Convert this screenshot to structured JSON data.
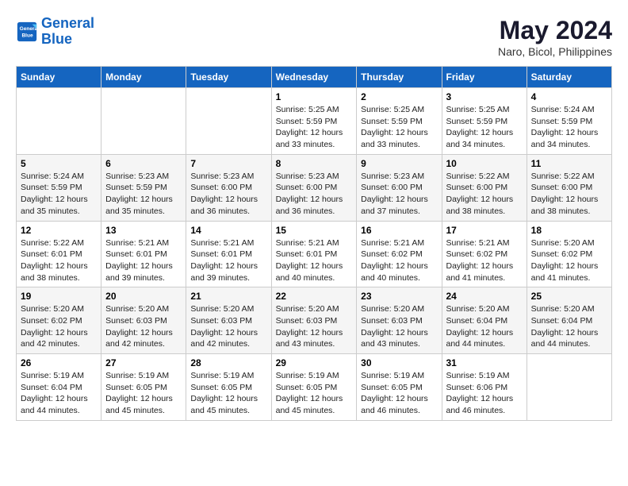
{
  "header": {
    "logo_line1": "General",
    "logo_line2": "Blue",
    "month_year": "May 2024",
    "location": "Naro, Bicol, Philippines"
  },
  "weekdays": [
    "Sunday",
    "Monday",
    "Tuesday",
    "Wednesday",
    "Thursday",
    "Friday",
    "Saturday"
  ],
  "weeks": [
    [
      {
        "day": "",
        "info": ""
      },
      {
        "day": "",
        "info": ""
      },
      {
        "day": "",
        "info": ""
      },
      {
        "day": "1",
        "info": "Sunrise: 5:25 AM\nSunset: 5:59 PM\nDaylight: 12 hours\nand 33 minutes."
      },
      {
        "day": "2",
        "info": "Sunrise: 5:25 AM\nSunset: 5:59 PM\nDaylight: 12 hours\nand 33 minutes."
      },
      {
        "day": "3",
        "info": "Sunrise: 5:25 AM\nSunset: 5:59 PM\nDaylight: 12 hours\nand 34 minutes."
      },
      {
        "day": "4",
        "info": "Sunrise: 5:24 AM\nSunset: 5:59 PM\nDaylight: 12 hours\nand 34 minutes."
      }
    ],
    [
      {
        "day": "5",
        "info": "Sunrise: 5:24 AM\nSunset: 5:59 PM\nDaylight: 12 hours\nand 35 minutes."
      },
      {
        "day": "6",
        "info": "Sunrise: 5:23 AM\nSunset: 5:59 PM\nDaylight: 12 hours\nand 35 minutes."
      },
      {
        "day": "7",
        "info": "Sunrise: 5:23 AM\nSunset: 6:00 PM\nDaylight: 12 hours\nand 36 minutes."
      },
      {
        "day": "8",
        "info": "Sunrise: 5:23 AM\nSunset: 6:00 PM\nDaylight: 12 hours\nand 36 minutes."
      },
      {
        "day": "9",
        "info": "Sunrise: 5:23 AM\nSunset: 6:00 PM\nDaylight: 12 hours\nand 37 minutes."
      },
      {
        "day": "10",
        "info": "Sunrise: 5:22 AM\nSunset: 6:00 PM\nDaylight: 12 hours\nand 38 minutes."
      },
      {
        "day": "11",
        "info": "Sunrise: 5:22 AM\nSunset: 6:00 PM\nDaylight: 12 hours\nand 38 minutes."
      }
    ],
    [
      {
        "day": "12",
        "info": "Sunrise: 5:22 AM\nSunset: 6:01 PM\nDaylight: 12 hours\nand 38 minutes."
      },
      {
        "day": "13",
        "info": "Sunrise: 5:21 AM\nSunset: 6:01 PM\nDaylight: 12 hours\nand 39 minutes."
      },
      {
        "day": "14",
        "info": "Sunrise: 5:21 AM\nSunset: 6:01 PM\nDaylight: 12 hours\nand 39 minutes."
      },
      {
        "day": "15",
        "info": "Sunrise: 5:21 AM\nSunset: 6:01 PM\nDaylight: 12 hours\nand 40 minutes."
      },
      {
        "day": "16",
        "info": "Sunrise: 5:21 AM\nSunset: 6:02 PM\nDaylight: 12 hours\nand 40 minutes."
      },
      {
        "day": "17",
        "info": "Sunrise: 5:21 AM\nSunset: 6:02 PM\nDaylight: 12 hours\nand 41 minutes."
      },
      {
        "day": "18",
        "info": "Sunrise: 5:20 AM\nSunset: 6:02 PM\nDaylight: 12 hours\nand 41 minutes."
      }
    ],
    [
      {
        "day": "19",
        "info": "Sunrise: 5:20 AM\nSunset: 6:02 PM\nDaylight: 12 hours\nand 42 minutes."
      },
      {
        "day": "20",
        "info": "Sunrise: 5:20 AM\nSunset: 6:03 PM\nDaylight: 12 hours\nand 42 minutes."
      },
      {
        "day": "21",
        "info": "Sunrise: 5:20 AM\nSunset: 6:03 PM\nDaylight: 12 hours\nand 42 minutes."
      },
      {
        "day": "22",
        "info": "Sunrise: 5:20 AM\nSunset: 6:03 PM\nDaylight: 12 hours\nand 43 minutes."
      },
      {
        "day": "23",
        "info": "Sunrise: 5:20 AM\nSunset: 6:03 PM\nDaylight: 12 hours\nand 43 minutes."
      },
      {
        "day": "24",
        "info": "Sunrise: 5:20 AM\nSunset: 6:04 PM\nDaylight: 12 hours\nand 44 minutes."
      },
      {
        "day": "25",
        "info": "Sunrise: 5:20 AM\nSunset: 6:04 PM\nDaylight: 12 hours\nand 44 minutes."
      }
    ],
    [
      {
        "day": "26",
        "info": "Sunrise: 5:19 AM\nSunset: 6:04 PM\nDaylight: 12 hours\nand 44 minutes."
      },
      {
        "day": "27",
        "info": "Sunrise: 5:19 AM\nSunset: 6:05 PM\nDaylight: 12 hours\nand 45 minutes."
      },
      {
        "day": "28",
        "info": "Sunrise: 5:19 AM\nSunset: 6:05 PM\nDaylight: 12 hours\nand 45 minutes."
      },
      {
        "day": "29",
        "info": "Sunrise: 5:19 AM\nSunset: 6:05 PM\nDaylight: 12 hours\nand 45 minutes."
      },
      {
        "day": "30",
        "info": "Sunrise: 5:19 AM\nSunset: 6:05 PM\nDaylight: 12 hours\nand 46 minutes."
      },
      {
        "day": "31",
        "info": "Sunrise: 5:19 AM\nSunset: 6:06 PM\nDaylight: 12 hours\nand 46 minutes."
      },
      {
        "day": "",
        "info": ""
      }
    ]
  ]
}
